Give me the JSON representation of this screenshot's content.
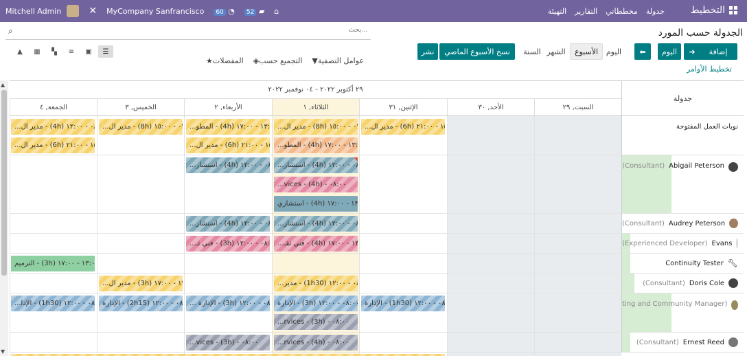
{
  "navbar": {
    "brand": "التخطيط",
    "menu": [
      "جدولة",
      "مخططاتي",
      "التقارير",
      "التهيئة"
    ],
    "user": "Mitchell Admin",
    "company": "MyCompany Sanfrancisco",
    "activity_count": "60",
    "messages_count": "52"
  },
  "control": {
    "title": "الجدولة حسب المورد",
    "search_placeholder": "بحث...",
    "add": "إضافة",
    "today": "اليوم",
    "scale_day": "اليوم",
    "scale_week": "الأسبوع",
    "scale_month": "الشهر",
    "scale_year": "السنة",
    "copy_prev": "نسخ الأسبوع الماضي",
    "publish": "نشر",
    "plan_orders": "تخطيط الأوامر",
    "filters": "عوامل التصفية",
    "group_by": "التجميع حسب",
    "favorites": "المفضلات"
  },
  "gantt": {
    "row_header": "جدولة",
    "range": "٢٩ أكتوبر ٢٠٢٢ - ٠٤ نوفمبر ٢٠٢٢",
    "days": [
      "السبت, ٢٩",
      "الأحد, ٣٠",
      "الإثنين, ٣١",
      "الثلاثاء, ١",
      "الأربعاء, ٢",
      "الخميس, ٣",
      "الجمعة, ٤"
    ],
    "rows": [
      {
        "name": "نوبات العمل المفتوحة",
        "role": "",
        "icon": ""
      },
      {
        "name": "Abigail Peterson",
        "role": "(Consultant)",
        "icon": "user-avatar-icon"
      },
      {
        "name": "Audrey Peterson",
        "role": "(Consultant)",
        "icon": "user-avatar-icon"
      },
      {
        "name": "Evans",
        "role": "(Experienced Developer)",
        "icon": "user-avatar-icon"
      },
      {
        "name": "Continuity Tester",
        "role": "",
        "icon": "wrench-icon"
      },
      {
        "name": "Doris Cole",
        "role": "(Consultant)",
        "icon": "user-avatar-icon"
      },
      {
        "name": "",
        "role": "ting and Community Manager)",
        "icon": "user-avatar-icon"
      },
      {
        "name": "Ernest Reed",
        "role": "(Consultant)",
        "icon": "user-avatar-icon"
      }
    ],
    "shifts": {
      "r0_mon": "١٥:٠٠ - ٢١:٠٠ (6h) - مدير ال...",
      "r0_tue_a": "٠٧:٠٠ - ١٥:٠٠ (8h) - مدير ال...",
      "r0_tue_b": "١٣:٠٠ - ١٧:٠٠ (4h) - المطو...",
      "r0_wed_a": "١٣:٠٠ - ١٧:٠٠ (4h) - المطو...",
      "r0_wed_b": "١٥:٠٠ - ٢١:٠٠ (6h) - مدير ال...",
      "r0_thu": "٠٧:٠٠ - ١٥:٠٠ (8h) - مدير ال...",
      "r0_fri_a": "٠٨:٠٠ - ١٢:٠٠ (4h) - مدير ال...",
      "r0_fri_b": "١٥:٠٠ - ٢١:٠٠ (6h) - مدير ال...",
      "r1_tue_a": "٠٨:٠٠ - ١٢:٠٠ (4h) - استشار...",
      "r1_tue_b": "٠٨:٠٠ - (4h) - vices...",
      "r1_tue_c": "١٣:٠٠ - ١٧:٠٠ (4h) - استشاري",
      "r1_wed": "٠٨:٠٠ - ١٢:٠٠ (4h) - استشار...",
      "r2_tue_a": "٠٨:٠٠ - ١٢:٠٠ (4h) - استشار...",
      "r2_tue_b": "١٣:٠٠ - ١٧:٠٠ (4h) - فني تقـ...",
      "r2_wed_a": "٠٨:٠٠ - ١٢:٠٠ (4h) - استشار...",
      "r2_wed_b": "٠٨:٠٠ - ١٢:٠٠ (3h) - فني تـ...",
      "r4_fri": "١٣:٠٠ - ١٧:٠٠ (3h) - الترميم",
      "r5_tue": "٠٨:٠٠ - ١٢:٠٠ (1h30) - مدير...",
      "r5_thu": "١٣:٠٠ - ١٧:٠٠ (3h) - مدير ال...",
      "r6_mon": "٠٨:٠٠ - ١٢:٠٠ (1h30) - الإدارة",
      "r6_tue_a": "٠٨:٠٠ - ١٢:٠٠ (3h) - الإدارة",
      "r6_tue_b": "٠٨:٠٠ - (3h) - rvices...",
      "r6_wed": "٠٨:٠٠ - ١٢:٠٠ (3h) - الإدارة ...",
      "r6_thu": "٠٨:٠٠ - ١٢:٠٠ (2h15) - الإدارة",
      "r6_fri": "٠٨:٠٠ - ١٢:٠٠ (1h30) - الإدا...",
      "r7_tue": "٠٨:٠٠ - (4h) - rvices...",
      "r7_wed": "٠٨:٠٠ - (3h) - vices..."
    }
  }
}
